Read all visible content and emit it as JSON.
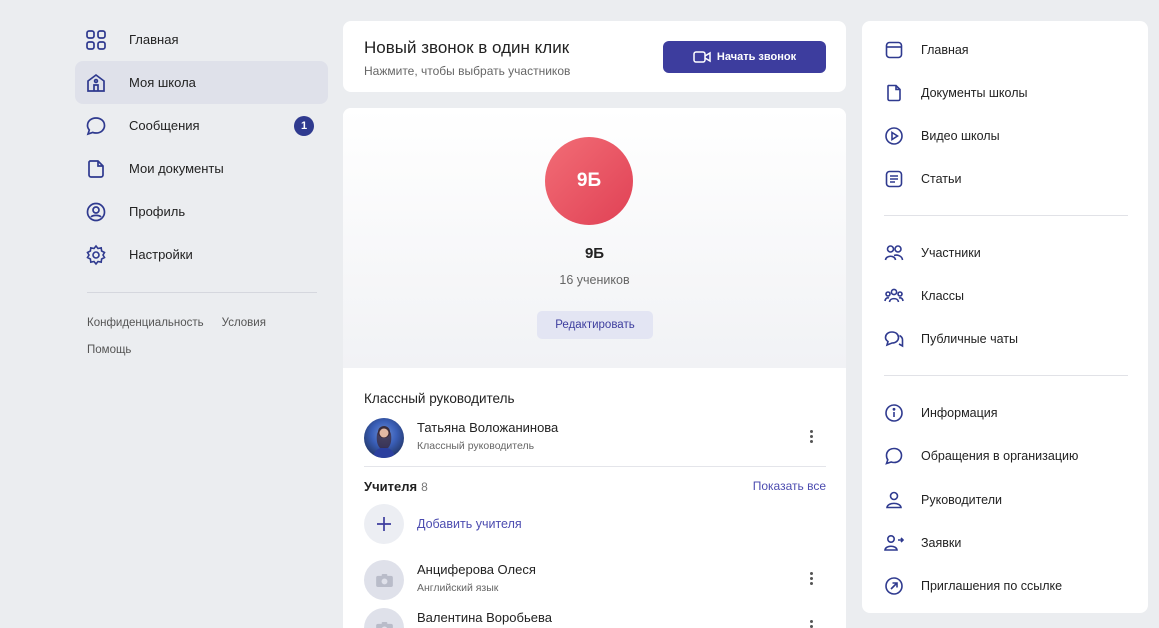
{
  "left_nav": {
    "items": [
      {
        "label": "Главная",
        "icon": "grid-icon"
      },
      {
        "label": "Моя школа",
        "icon": "school-icon"
      },
      {
        "label": "Сообщения",
        "icon": "chat-bubble-icon",
        "badge": "1"
      },
      {
        "label": "Мои документы",
        "icon": "document-icon"
      },
      {
        "label": "Профиль",
        "icon": "profile-icon"
      },
      {
        "label": "Настройки",
        "icon": "gear-icon"
      }
    ],
    "active_index": 1,
    "footer": {
      "privacy": "Конфиденциальность",
      "terms": "Условия",
      "help": "Помощь"
    }
  },
  "call": {
    "title": "Новый звонок в один клик",
    "subtitle": "Нажмите, чтобы выбрать участников",
    "button": "Начать звонок"
  },
  "class": {
    "avatar_text": "9Б",
    "name": "9Б",
    "count": "16 учеников",
    "edit": "Редактировать",
    "homeroom_title": "Классный руководитель",
    "homeroom": {
      "name": "Татьяна Воложанинова",
      "role": "Классный руководитель"
    },
    "teachers_title": "Учителя",
    "teachers_count": "8",
    "show_all": "Показать все",
    "add_teacher": "Добавить учителя",
    "teachers": [
      {
        "name": "Анциферова Олеся",
        "subject": "Английский язык"
      },
      {
        "name": "Валентина Воробьева",
        "subject": ""
      }
    ]
  },
  "right_nav": {
    "group1": [
      {
        "label": "Главная",
        "icon": "calendar-icon"
      },
      {
        "label": "Документы школы",
        "icon": "document-icon"
      },
      {
        "label": "Видео школы",
        "icon": "play-icon"
      },
      {
        "label": "Статьи",
        "icon": "article-icon"
      }
    ],
    "group2": [
      {
        "label": "Участники",
        "icon": "users-icon"
      },
      {
        "label": "Классы",
        "icon": "group-icon"
      },
      {
        "label": "Публичные чаты",
        "icon": "chats-icon"
      }
    ],
    "group3": [
      {
        "label": "Информация",
        "icon": "info-icon"
      },
      {
        "label": "Обращения в организацию",
        "icon": "chat-bubble-icon"
      },
      {
        "label": "Руководители",
        "icon": "user-icon"
      },
      {
        "label": "Заявки",
        "icon": "user-arrow-icon"
      },
      {
        "label": "Приглашения по ссылке",
        "icon": "link-arrow-icon"
      }
    ]
  },
  "colors": {
    "accent": "#3d3d9e",
    "badge": "#2f3a8f",
    "avatar_red": "#e8505f",
    "link": "#4c4cb0",
    "active_bg": "#dfe1ea",
    "page_bg": "#ebedf0"
  }
}
